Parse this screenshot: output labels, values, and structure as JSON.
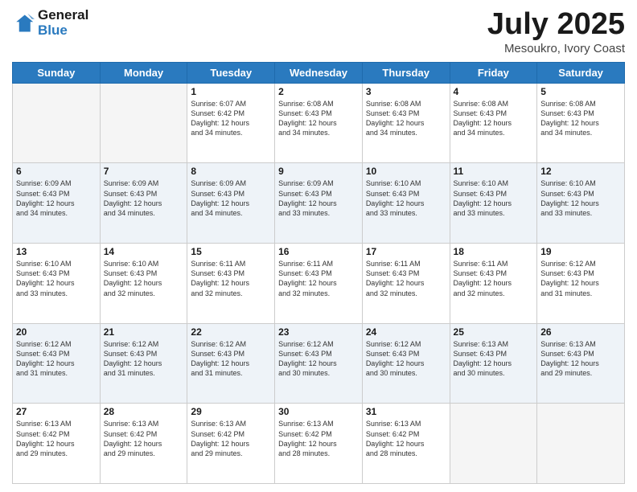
{
  "logo": {
    "general": "General",
    "blue": "Blue"
  },
  "header": {
    "title": "July 2025",
    "subtitle": "Mesoukro, Ivory Coast"
  },
  "days_of_week": [
    "Sunday",
    "Monday",
    "Tuesday",
    "Wednesday",
    "Thursday",
    "Friday",
    "Saturday"
  ],
  "weeks": [
    [
      {
        "day": "",
        "info": ""
      },
      {
        "day": "",
        "info": ""
      },
      {
        "day": "1",
        "info": "Sunrise: 6:07 AM\nSunset: 6:42 PM\nDaylight: 12 hours\nand 34 minutes."
      },
      {
        "day": "2",
        "info": "Sunrise: 6:08 AM\nSunset: 6:43 PM\nDaylight: 12 hours\nand 34 minutes."
      },
      {
        "day": "3",
        "info": "Sunrise: 6:08 AM\nSunset: 6:43 PM\nDaylight: 12 hours\nand 34 minutes."
      },
      {
        "day": "4",
        "info": "Sunrise: 6:08 AM\nSunset: 6:43 PM\nDaylight: 12 hours\nand 34 minutes."
      },
      {
        "day": "5",
        "info": "Sunrise: 6:08 AM\nSunset: 6:43 PM\nDaylight: 12 hours\nand 34 minutes."
      }
    ],
    [
      {
        "day": "6",
        "info": "Sunrise: 6:09 AM\nSunset: 6:43 PM\nDaylight: 12 hours\nand 34 minutes."
      },
      {
        "day": "7",
        "info": "Sunrise: 6:09 AM\nSunset: 6:43 PM\nDaylight: 12 hours\nand 34 minutes."
      },
      {
        "day": "8",
        "info": "Sunrise: 6:09 AM\nSunset: 6:43 PM\nDaylight: 12 hours\nand 34 minutes."
      },
      {
        "day": "9",
        "info": "Sunrise: 6:09 AM\nSunset: 6:43 PM\nDaylight: 12 hours\nand 33 minutes."
      },
      {
        "day": "10",
        "info": "Sunrise: 6:10 AM\nSunset: 6:43 PM\nDaylight: 12 hours\nand 33 minutes."
      },
      {
        "day": "11",
        "info": "Sunrise: 6:10 AM\nSunset: 6:43 PM\nDaylight: 12 hours\nand 33 minutes."
      },
      {
        "day": "12",
        "info": "Sunrise: 6:10 AM\nSunset: 6:43 PM\nDaylight: 12 hours\nand 33 minutes."
      }
    ],
    [
      {
        "day": "13",
        "info": "Sunrise: 6:10 AM\nSunset: 6:43 PM\nDaylight: 12 hours\nand 33 minutes."
      },
      {
        "day": "14",
        "info": "Sunrise: 6:10 AM\nSunset: 6:43 PM\nDaylight: 12 hours\nand 32 minutes."
      },
      {
        "day": "15",
        "info": "Sunrise: 6:11 AM\nSunset: 6:43 PM\nDaylight: 12 hours\nand 32 minutes."
      },
      {
        "day": "16",
        "info": "Sunrise: 6:11 AM\nSunset: 6:43 PM\nDaylight: 12 hours\nand 32 minutes."
      },
      {
        "day": "17",
        "info": "Sunrise: 6:11 AM\nSunset: 6:43 PM\nDaylight: 12 hours\nand 32 minutes."
      },
      {
        "day": "18",
        "info": "Sunrise: 6:11 AM\nSunset: 6:43 PM\nDaylight: 12 hours\nand 32 minutes."
      },
      {
        "day": "19",
        "info": "Sunrise: 6:12 AM\nSunset: 6:43 PM\nDaylight: 12 hours\nand 31 minutes."
      }
    ],
    [
      {
        "day": "20",
        "info": "Sunrise: 6:12 AM\nSunset: 6:43 PM\nDaylight: 12 hours\nand 31 minutes."
      },
      {
        "day": "21",
        "info": "Sunrise: 6:12 AM\nSunset: 6:43 PM\nDaylight: 12 hours\nand 31 minutes."
      },
      {
        "day": "22",
        "info": "Sunrise: 6:12 AM\nSunset: 6:43 PM\nDaylight: 12 hours\nand 31 minutes."
      },
      {
        "day": "23",
        "info": "Sunrise: 6:12 AM\nSunset: 6:43 PM\nDaylight: 12 hours\nand 30 minutes."
      },
      {
        "day": "24",
        "info": "Sunrise: 6:12 AM\nSunset: 6:43 PM\nDaylight: 12 hours\nand 30 minutes."
      },
      {
        "day": "25",
        "info": "Sunrise: 6:13 AM\nSunset: 6:43 PM\nDaylight: 12 hours\nand 30 minutes."
      },
      {
        "day": "26",
        "info": "Sunrise: 6:13 AM\nSunset: 6:43 PM\nDaylight: 12 hours\nand 29 minutes."
      }
    ],
    [
      {
        "day": "27",
        "info": "Sunrise: 6:13 AM\nSunset: 6:42 PM\nDaylight: 12 hours\nand 29 minutes."
      },
      {
        "day": "28",
        "info": "Sunrise: 6:13 AM\nSunset: 6:42 PM\nDaylight: 12 hours\nand 29 minutes."
      },
      {
        "day": "29",
        "info": "Sunrise: 6:13 AM\nSunset: 6:42 PM\nDaylight: 12 hours\nand 29 minutes."
      },
      {
        "day": "30",
        "info": "Sunrise: 6:13 AM\nSunset: 6:42 PM\nDaylight: 12 hours\nand 28 minutes."
      },
      {
        "day": "31",
        "info": "Sunrise: 6:13 AM\nSunset: 6:42 PM\nDaylight: 12 hours\nand 28 minutes."
      },
      {
        "day": "",
        "info": ""
      },
      {
        "day": "",
        "info": ""
      }
    ]
  ]
}
